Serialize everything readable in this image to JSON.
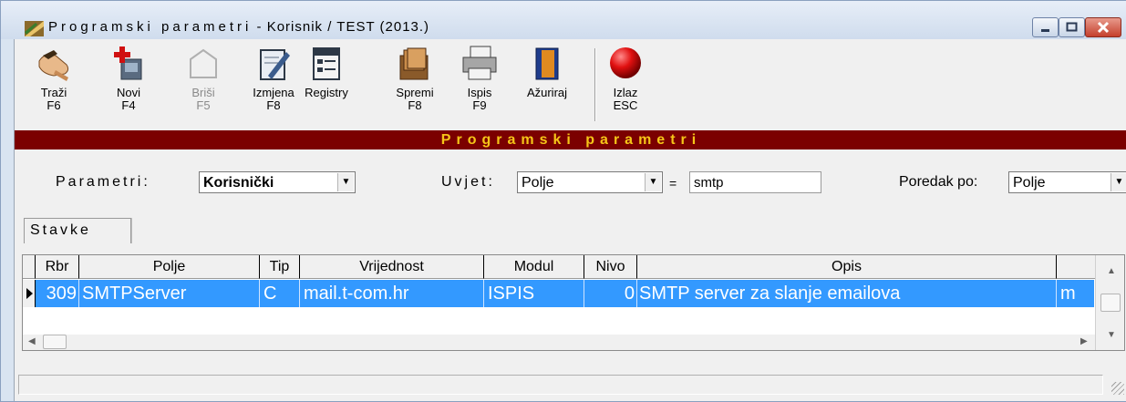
{
  "window": {
    "title_spaced": "Programski parametri",
    "title_rest": " - Korisnik / TEST (2013.)",
    "minimize_icon": "minimize-icon",
    "maximize_icon": "maximize-icon",
    "close_icon": "close-icon"
  },
  "toolbar": {
    "items": [
      {
        "label": "Traži",
        "key": "F6",
        "icon": "hand-search-icon",
        "enabled": true
      },
      {
        "label": "Novi",
        "key": "F4",
        "icon": "new-record-icon",
        "enabled": true
      },
      {
        "label": "Briši",
        "key": "F5",
        "icon": "delete-icon",
        "enabled": false
      },
      {
        "label": "Izmjena",
        "key": "F8",
        "icon": "edit-icon",
        "enabled": true
      },
      {
        "label": "Registry",
        "key": "",
        "icon": "registry-icon",
        "enabled": true
      },
      {
        "label": "Spremi",
        "key": "F8",
        "icon": "save-folder-icon",
        "enabled": true
      },
      {
        "label": "Ispis",
        "key": "F9",
        "icon": "printer-icon",
        "enabled": true
      },
      {
        "label": "Ažuriraj",
        "key": "",
        "icon": "update-book-icon",
        "enabled": true
      },
      {
        "label": "Izlaz",
        "key": "ESC",
        "icon": "exit-red-ball-icon",
        "enabled": true
      }
    ]
  },
  "banner": {
    "text": "Programski parametri"
  },
  "filters": {
    "parametri_label": "Parametri:",
    "parametri_value": "Korisnički",
    "uvjet_label": "Uvjet:",
    "uvjet_field": "Polje",
    "equals": "=",
    "uvjet_value": "smtp",
    "poredak_label": "Poredak po:",
    "poredak_value": "Polje"
  },
  "tab": {
    "label": "Stavke"
  },
  "grid": {
    "columns": [
      "Rbr",
      "Polje",
      "Tip",
      "Vrijednost",
      "Modul",
      "Nivo",
      "Opis",
      ""
    ],
    "rows": [
      {
        "rbr": "309",
        "polje": "SMTPServer",
        "tip": "C",
        "vrijednost": "mail.t-com.hr",
        "modul": "ISPIS",
        "nivo": "0",
        "opis": "SMTP server za slanje emailova",
        "extra": "m"
      }
    ]
  },
  "colors": {
    "banner_bg": "#7b0000",
    "banner_text": "#f5c518",
    "selection": "#3399ff"
  }
}
